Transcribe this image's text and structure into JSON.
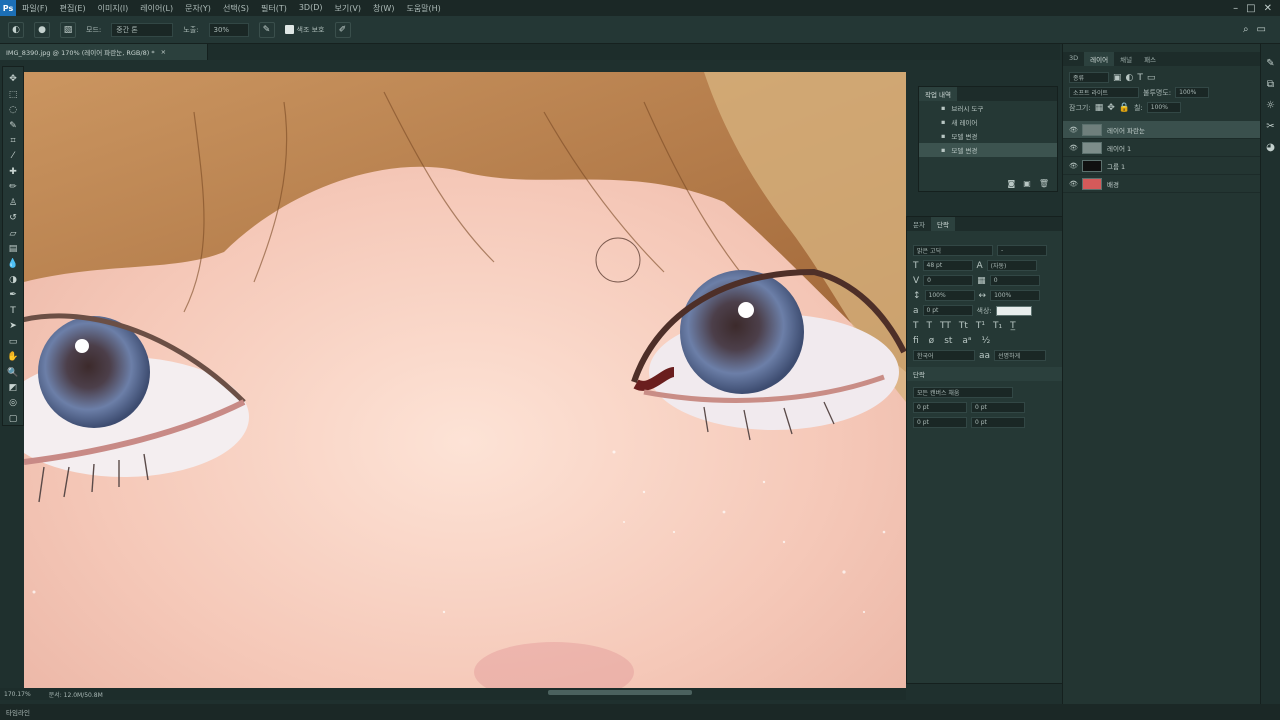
{
  "app": {
    "logo_text": "Ps"
  },
  "menu": [
    "파일(F)",
    "편집(E)",
    "이미지(I)",
    "레이어(L)",
    "문자(Y)",
    "선택(S)",
    "필터(T)",
    "3D(D)",
    "보기(V)",
    "창(W)",
    "도움말(H)"
  ],
  "options": {
    "mode_label": "모드:",
    "mode_value": "중간 톤",
    "exposure_label": "노출:",
    "exposure_value": "30%",
    "protect_label": "색조 보호"
  },
  "document_tab": {
    "title": "IMG_8390.jpg @ 170% (레이어 파란눈, RGB/8) *",
    "close": "×"
  },
  "history": {
    "title": "작업 내역",
    "items": [
      "브러시 도구",
      "새 레이어",
      "모델 변경",
      "모델 변경"
    ]
  },
  "layers_panel": {
    "tabs": [
      "3D",
      "레이어",
      "채널",
      "패스"
    ],
    "kind_label": "종류",
    "blend_mode": "소프트 라이트",
    "opacity_label": "불투명도:",
    "opacity_value": "100%",
    "lock_label": "잠그기:",
    "fill_label": "칠:",
    "fill_value": "100%",
    "layers": [
      {
        "name": "레이어 파란눈",
        "active": true,
        "thumb_color": "#6f7f7c"
      },
      {
        "name": "레이어 1",
        "active": false,
        "thumb_color": "#7d8d8a"
      },
      {
        "name": "그룹 1",
        "active": false,
        "thumb_color": "#101010"
      },
      {
        "name": "배경",
        "active": false,
        "thumb_color": "#d45a5a"
      }
    ]
  },
  "character_panel": {
    "tabs": [
      "문자",
      "단락"
    ],
    "font": "맑은 고딕",
    "font_style": "-",
    "size": "48 pt",
    "leading": "(자동)",
    "kerning": "0",
    "tracking": "0",
    "vscale": "100%",
    "hscale": "100%",
    "baseline": "0 pt",
    "color_label": "색상:",
    "language": "한국어",
    "antialias": "선명하게",
    "para_head": "단락",
    "para_tab": "모든 캔버스 채움",
    "indent_left": "0 pt",
    "indent_right": "0 pt",
    "space_before": "0 pt",
    "space_after": "0 pt"
  },
  "status": {
    "zoom": "170.17%",
    "doc": "문서: 12.0M/50.8M"
  },
  "bottombar": {
    "label": "타임라인"
  },
  "colors": {
    "canvas_skin": "#f1c7b8",
    "eye_iris": "#5d6f96",
    "hair": "#b97a3f"
  }
}
